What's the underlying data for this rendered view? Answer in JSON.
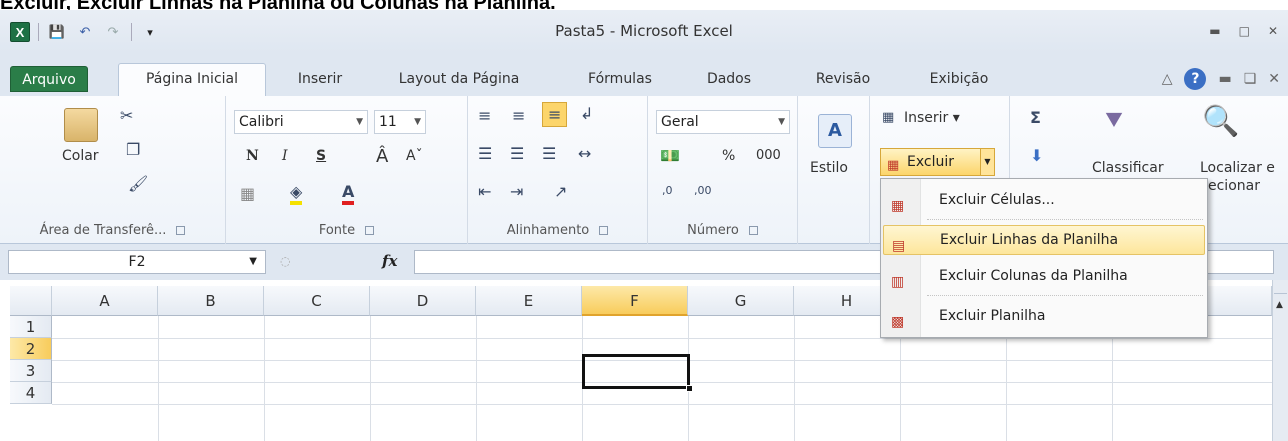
{
  "caption": "Excluir, Excluir Linhas na Planilha ou Colunas na Planilha.",
  "window": {
    "title": "Pasta5 - Microsoft Excel",
    "qat_icons": [
      "excel-logo-icon",
      "save-icon",
      "undo-icon",
      "redo-icon",
      "customize-qat-icon"
    ]
  },
  "tabs": [
    {
      "label": "Arquivo"
    },
    {
      "label": "Página Inicial"
    },
    {
      "label": "Inserir"
    },
    {
      "label": "Layout da Página"
    },
    {
      "label": "Fórmulas"
    },
    {
      "label": "Dados"
    },
    {
      "label": "Revisão"
    },
    {
      "label": "Exibição"
    }
  ],
  "ribbon": {
    "clipboard": {
      "label": "Área de Transferê...",
      "paste": "Colar"
    },
    "font": {
      "label": "Fonte",
      "name": "Calibri",
      "size": "11",
      "bold": "N",
      "italic": "I",
      "underline": "S"
    },
    "alignment": {
      "label": "Alinhamento"
    },
    "number": {
      "label": "Número",
      "format": "Geral",
      "percent": "%",
      "thousands": "000"
    },
    "styles": {
      "label": "Estilo"
    },
    "cells": {
      "insert": "Inserir",
      "delete": "Excluir"
    },
    "editing": {
      "sort": "Classificar",
      "find": "Localizar e",
      "find2": "ecionar"
    }
  },
  "formula_bar": {
    "namebox": "F2",
    "fx": "fx",
    "value": ""
  },
  "sheet": {
    "columns": [
      "A",
      "B",
      "C",
      "D",
      "E",
      "F",
      "G",
      "H"
    ],
    "rows": [
      "1",
      "2",
      "3",
      "4"
    ],
    "selected_cell": "F2"
  },
  "menu": {
    "items": [
      {
        "label": "Excluir Células...",
        "icon": "delete-cells-icon"
      },
      {
        "label": "Excluir Linhas da Planilha",
        "icon": "delete-rows-icon",
        "highlighted": true
      },
      {
        "label": "Excluir Colunas da Planilha",
        "icon": "delete-columns-icon"
      },
      {
        "label": "Excluir Planilha",
        "icon": "delete-sheet-icon"
      }
    ]
  },
  "colors": {
    "file_tab": "#2a7d48",
    "highlight": "#fde69b",
    "selected_header": "#f8cc5c"
  }
}
